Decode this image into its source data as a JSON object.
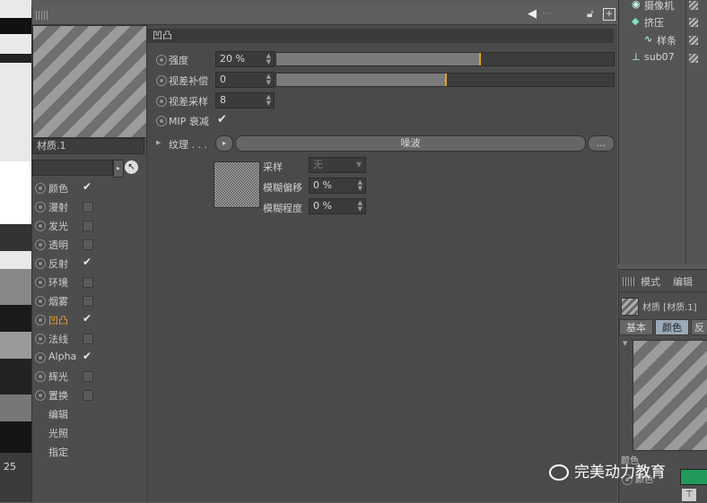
{
  "viewport": {
    "frame_number": "25"
  },
  "editor": {
    "material_name": "材质.1",
    "channels": [
      {
        "label": "颜色",
        "checked": true,
        "has_radio": true,
        "active": false
      },
      {
        "label": "漫射",
        "checked": false,
        "has_radio": true,
        "active": false
      },
      {
        "label": "发光",
        "checked": false,
        "has_radio": true,
        "active": false
      },
      {
        "label": "透明",
        "checked": false,
        "has_radio": true,
        "active": false
      },
      {
        "label": "反射",
        "checked": true,
        "has_radio": true,
        "active": false
      },
      {
        "label": "环境",
        "checked": false,
        "has_radio": true,
        "active": false
      },
      {
        "label": "烟雾",
        "checked": false,
        "has_radio": true,
        "active": false
      },
      {
        "label": "凹凸",
        "checked": true,
        "has_radio": true,
        "active": true
      },
      {
        "label": "法线",
        "checked": false,
        "has_radio": true,
        "active": false
      },
      {
        "label": "Alpha",
        "checked": true,
        "has_radio": true,
        "active": false
      },
      {
        "label": "辉光",
        "checked": false,
        "has_radio": true,
        "active": false
      },
      {
        "label": "置换",
        "checked": false,
        "has_radio": true,
        "active": false
      }
    ],
    "extra_items": [
      "编辑",
      "光照",
      "指定"
    ],
    "section_title": "凹凸",
    "params": {
      "strength": {
        "label": "强度",
        "value": "20 %",
        "level": 0.2
      },
      "parallax_offset": {
        "label": "视差补偿",
        "value": "0",
        "level": 0.0
      },
      "parallax_samples": {
        "label": "视差采样",
        "value": "8"
      },
      "mip": {
        "label": "MIP 衰减",
        "checked": true
      }
    },
    "texture": {
      "label": "纹理 . . .",
      "shader": "噪波",
      "more_button": "...",
      "sampling_label": "采样",
      "sampling_value": "无",
      "blur_offset_label": "模糊偏移",
      "blur_offset_value": "0 %",
      "blur_scale_label": "模糊程度",
      "blur_scale_value": "0 %"
    }
  },
  "objects": {
    "items": [
      {
        "label": "摄像机",
        "icon": "camera-icon"
      },
      {
        "label": "挤压",
        "icon": "extrude-icon"
      },
      {
        "label": "样条",
        "icon": "spline-icon"
      },
      {
        "label": "sub07",
        "icon": "null-object-icon"
      }
    ]
  },
  "attributes": {
    "menu": [
      "模式",
      "编辑"
    ],
    "header": "材质 [材质.1]",
    "tabs": [
      "基本",
      "颜色",
      "反"
    ],
    "active_tab": "颜色",
    "color_label": "颜色",
    "color_swatch": "#1f9a5a"
  },
  "watermark": "完美动力教育",
  "colors": {
    "accent": "#e0a020",
    "active_channel": "#f0a030"
  }
}
